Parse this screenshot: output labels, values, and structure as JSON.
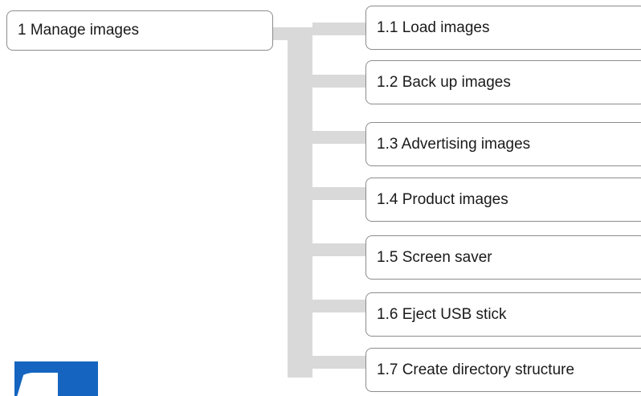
{
  "root": {
    "label": "1 Manage images"
  },
  "children": [
    {
      "label": "1.1 Load images"
    },
    {
      "label": "1.2 Back up images"
    },
    {
      "label": "1.3 Advertising images"
    },
    {
      "label": "1.4 Product images"
    },
    {
      "label": "1.5 Screen saver"
    },
    {
      "label": "1.6 Eject USB stick"
    },
    {
      "label": "1.7 Create directory structure"
    }
  ],
  "colors": {
    "connector": "#d9d9d9",
    "border": "#8c8c8c",
    "logo": "#1565c0"
  },
  "icons": {
    "corner_logo": "logo-mark-icon"
  }
}
